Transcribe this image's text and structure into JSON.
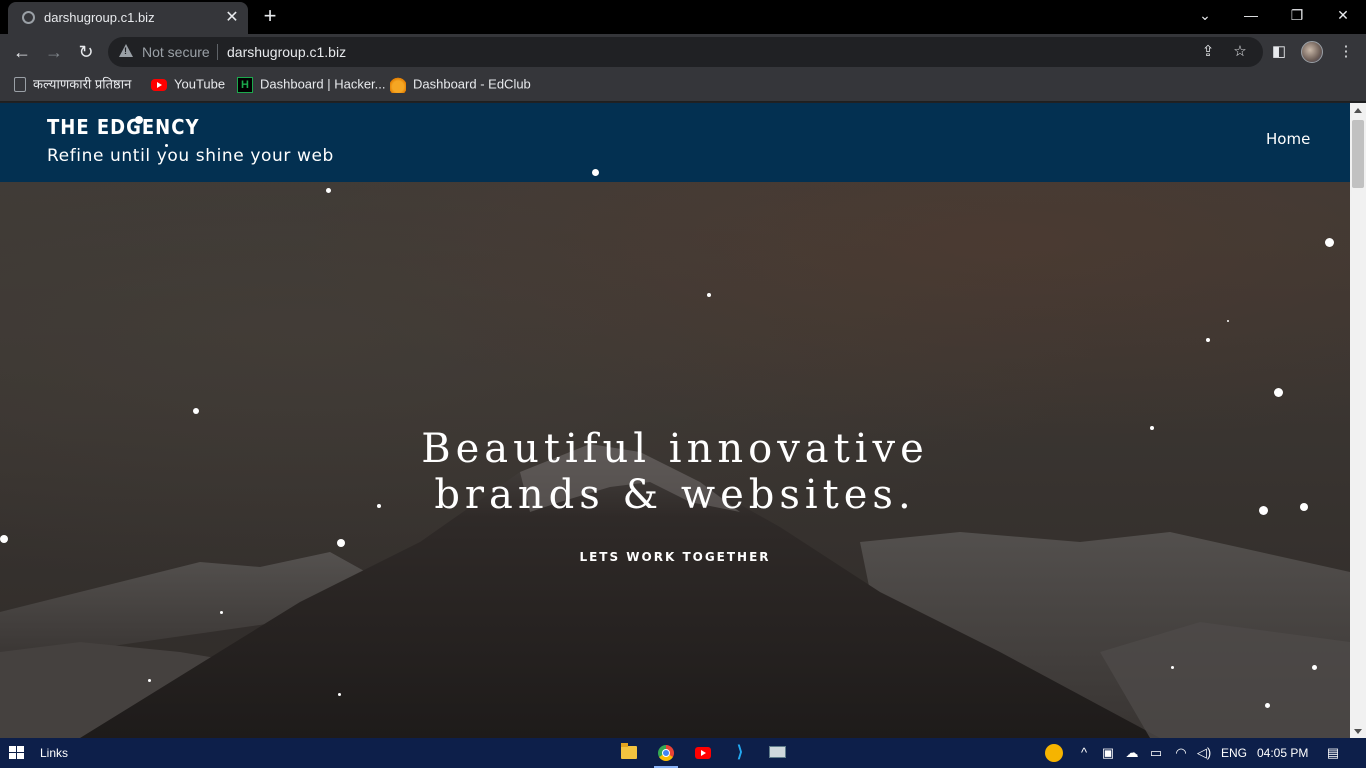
{
  "browser": {
    "tab_title": "darshugroup.c1.biz",
    "security_label": "Not secure",
    "url": "darshugroup.c1.biz",
    "bookmarks": [
      {
        "label": "कल्याणकारी प्रतिष्ठान",
        "icon": "shield-icon"
      },
      {
        "label": "YouTube",
        "icon": "youtube-icon"
      },
      {
        "label": "Dashboard | Hacker...",
        "icon": "hackerrank-icon"
      },
      {
        "label": "Dashboard - EdClub",
        "icon": "edclub-icon"
      }
    ]
  },
  "site": {
    "brand": "THE EDGENCY",
    "tagline": "Refine until you shine your web",
    "nav": {
      "home": "Home"
    },
    "hero": {
      "title_line1": "Beautiful innovative",
      "title_line2": "brands & websites.",
      "cta": "LETS WORK TOGETHER"
    }
  },
  "taskbar": {
    "search_label": "Links",
    "apps": [
      "file-explorer-icon",
      "chrome-icon",
      "youtube-icon",
      "vscode-icon",
      "remote-desktop-icon"
    ],
    "language": "ENG",
    "time": "04:05 PM"
  },
  "colors": {
    "header_bg": "#033051",
    "taskbar_bg": "#0d1f4a",
    "browser_chrome": "#35363a"
  }
}
